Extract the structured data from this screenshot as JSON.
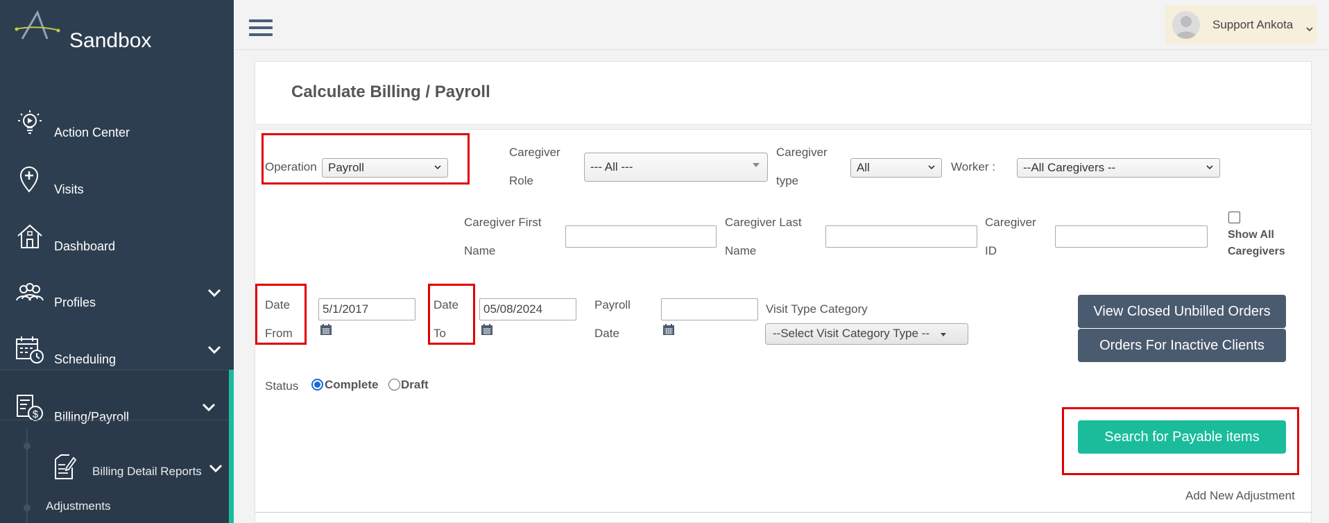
{
  "sidebar": {
    "brand": "Sandbox",
    "items": [
      {
        "label": "Action Center",
        "icon": "lightbulb-icon"
      },
      {
        "label": "Visits",
        "icon": "map-pin-plus-icon"
      },
      {
        "label": "Dashboard",
        "icon": "home-icon"
      },
      {
        "label": "Profiles",
        "icon": "people-group-icon"
      },
      {
        "label": "Scheduling",
        "icon": "calendar-clock-icon"
      },
      {
        "label": "Billing/Payroll",
        "icon": "billing-dollar-icon"
      }
    ],
    "sub_items": [
      {
        "label": "Billing Detail Reports",
        "icon": "document-edit-icon"
      },
      {
        "label": "Adjustments"
      }
    ]
  },
  "header": {
    "user_name": "Support Ankota"
  },
  "page": {
    "title": "Calculate Billing / Payroll"
  },
  "form": {
    "operation_label": "Operation",
    "operation_value": "Payroll",
    "caregiver_role_label_1": "Caregiver",
    "caregiver_role_label_2": "Role",
    "caregiver_role_value": "--- All ---",
    "caregiver_type_label_1": "Caregiver",
    "caregiver_type_label_2": "type",
    "caregiver_type_value": "All",
    "worker_label": "Worker :",
    "worker_value": "--All Caregivers --",
    "first_name_label_1": "Caregiver First",
    "first_name_label_2": "Name",
    "first_name_value": "",
    "last_name_label_1": "Caregiver Last",
    "last_name_label_2": "Name",
    "last_name_value": "",
    "caregiver_id_label_1": "Caregiver",
    "caregiver_id_label_2": "ID",
    "caregiver_id_value": "",
    "show_all_label_1": "Show All",
    "show_all_label_2": "Caregivers",
    "date_from_label_1": "Date",
    "date_from_label_2": "From",
    "date_from_value": "5/1/2017",
    "date_to_label_1": "Date",
    "date_to_label_2": "To",
    "date_to_value": "05/08/2024",
    "payroll_date_label_1": "Payroll",
    "payroll_date_label_2": "Date",
    "payroll_date_value": "",
    "visit_type_label": "Visit Type Category",
    "visit_type_value": "--Select Visit Category Type --",
    "status_label": "Status",
    "status_complete": "Complete",
    "status_draft": "Draft",
    "status_selected": "Complete",
    "btn_closed_unbilled": "View Closed Unbilled Orders",
    "btn_inactive_clients": "Orders For Inactive Clients",
    "btn_search": "Search for Payable items",
    "add_adjustment": "Add New Adjustment"
  },
  "colors": {
    "sidebar_bg": "#2d3e50",
    "accent": "#1abc9c",
    "dark_button": "#4a5a6f",
    "highlight_box": "#e00000"
  }
}
